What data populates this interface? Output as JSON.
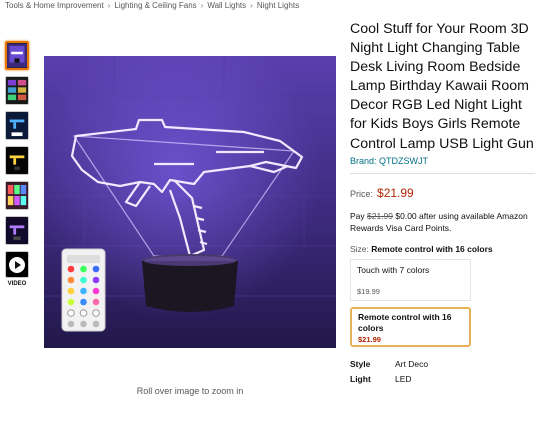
{
  "breadcrumb": {
    "items": [
      "Tools & Home Improvement",
      "Lighting & Ceiling Fans",
      "Wall Lights",
      "Night Lights"
    ],
    "separator": "›"
  },
  "thumbnails": {
    "count": 7,
    "selected_index": 0,
    "video_label": "VIDEO"
  },
  "main_image": {
    "zoom_hint": "Roll over image to zoom in",
    "remote_rows": 4,
    "remote_cols": 3
  },
  "product": {
    "title": "Cool Stuff for Your Room 3D Night Light Changing Table Desk Living Room Bedside Lamp Birthday Kawaii Room Decor RGB Led Night Light for Kids Boys Girls Remote Control Lamp USB Light Gun",
    "brand_label": "Brand: ",
    "brand_value": "QTDZSWJT",
    "price_label": "Price:",
    "price_value": "$21.99",
    "promo_prefix": "Pay ",
    "promo_strike": "$21.99",
    "promo_rest": " $0.00 after using available Amazon Rewards Visa Card Points."
  },
  "size": {
    "label": "Size: ",
    "selected_value": "Remote control with 16 colors",
    "options": [
      {
        "name": "Touch with 7 colors",
        "price": "$19.99"
      },
      {
        "name": "Remote control with 16 colors",
        "price": "$21.99"
      }
    ]
  },
  "specs": [
    {
      "key": "Style",
      "value": "Art Deco"
    },
    {
      "key": "Light",
      "value": "LED"
    }
  ],
  "colors": {
    "price_red": "#b12704",
    "link_teal": "#007185",
    "selected_orange": "#e77600",
    "option_gold": "#e7b155",
    "neon_purple": "#c77dff"
  }
}
